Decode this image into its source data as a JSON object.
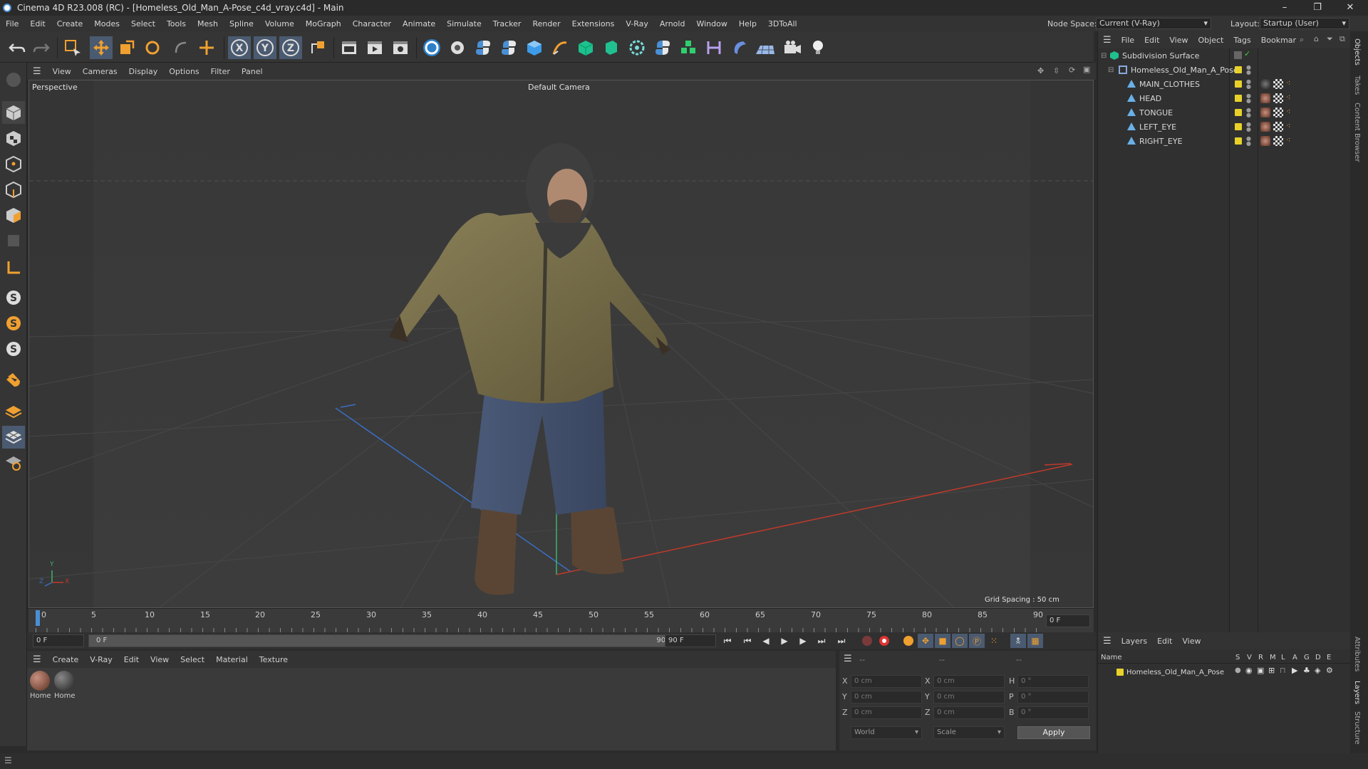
{
  "window": {
    "title": "Cinema 4D R23.008 (RC) - [Homeless_Old_Man_A-Pose_c4d_vray.c4d] - Main",
    "minimize": "–",
    "maximize": "❐",
    "close": "✕"
  },
  "menu": [
    "File",
    "Edit",
    "Create",
    "Modes",
    "Select",
    "Tools",
    "Mesh",
    "Spline",
    "Volume",
    "MoGraph",
    "Character",
    "Animate",
    "Simulate",
    "Tracker",
    "Render",
    "Extensions",
    "V-Ray",
    "Arnold",
    "Window",
    "Help",
    "3DToAll"
  ],
  "node_space": {
    "label": "Node Space:",
    "value": "Current (V-Ray)"
  },
  "layout": {
    "label": "Layout:",
    "value": "Startup (User)"
  },
  "viewport_menu": [
    "View",
    "Cameras",
    "Display",
    "Options",
    "Filter",
    "Panel"
  ],
  "viewport": {
    "name": "Perspective",
    "camera": "Default Camera",
    "grid_spacing": "Grid Spacing : 50 cm",
    "axis_y": "Y",
    "axis_x": "X",
    "axis_z": "Z"
  },
  "timeline": {
    "ticks": [
      "0",
      "5",
      "10",
      "15",
      "20",
      "25",
      "30",
      "35",
      "40",
      "45",
      "50",
      "55",
      "60",
      "65",
      "70",
      "75",
      "80",
      "85",
      "90"
    ],
    "current_frame": "0 F"
  },
  "transport": {
    "start": "0 F",
    "range_start": "0 F",
    "range_end": "90 F",
    "end": "90 F"
  },
  "material_menu": [
    "Create",
    "V-Ray",
    "Edit",
    "View",
    "Select",
    "Material",
    "Texture"
  ],
  "materials": [
    {
      "label": "Home"
    },
    {
      "label": "Home"
    }
  ],
  "attrs": {
    "col1": "--",
    "col2": "--",
    "col3": "--",
    "rows": [
      {
        "a": "X",
        "av": "0 cm",
        "b": "X",
        "bv": "0 cm",
        "c": "H",
        "cv": "0 °"
      },
      {
        "a": "Y",
        "av": "0 cm",
        "b": "Y",
        "bv": "0 cm",
        "c": "P",
        "cv": "0 °"
      },
      {
        "a": "Z",
        "av": "0 cm",
        "b": "Z",
        "bv": "0 cm",
        "c": "B",
        "cv": "0 °"
      }
    ],
    "coord": "World",
    "mode": "Scale",
    "apply": "Apply"
  },
  "objects_menu": [
    "File",
    "Edit",
    "View",
    "Object",
    "Tags",
    "Bookmar"
  ],
  "objects": [
    {
      "name": "Subdivision Surface",
      "indent": 0
    },
    {
      "name": "Homeless_Old_Man_A_Pose",
      "indent": 1
    },
    {
      "name": "MAIN_CLOTHES",
      "indent": 2
    },
    {
      "name": "HEAD",
      "indent": 2
    },
    {
      "name": "TONGUE",
      "indent": 2
    },
    {
      "name": "LEFT_EYE",
      "indent": 2
    },
    {
      "name": "RIGHT_EYE",
      "indent": 2
    }
  ],
  "layers_menu": [
    "Layers",
    "Edit",
    "View"
  ],
  "layers_header": {
    "name": "Name",
    "cols": [
      "S",
      "V",
      "R",
      "M",
      "L",
      "A",
      "G",
      "D",
      "E"
    ]
  },
  "layers": [
    {
      "name": "Homeless_Old_Man_A_Pose"
    }
  ],
  "right_tabs": [
    "Objects",
    "Takes",
    "Content Browser",
    "Attributes",
    "Layers",
    "Structure"
  ],
  "colors": {
    "accent": "#4a8fd4",
    "tag_yellow": "#e8d22a",
    "x_axis": "#c0392b",
    "y_axis": "#3bb36a",
    "z_axis": "#3a6fc4"
  }
}
